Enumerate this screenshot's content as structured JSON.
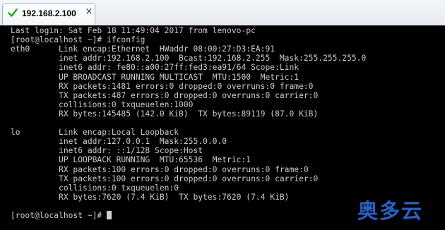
{
  "tab": {
    "label": "192.168.2.100",
    "status_color": "#2aa82a",
    "status_icon": "check-icon",
    "close_icon": "close-icon",
    "close_glyph": "×"
  },
  "terminal": {
    "lines": [
      "Last login: Sat Feb 18 11:49:04 2017 from lenovo-pc",
      "[root@localhost ~]# ifconfig",
      "eth0      Link encap:Ethernet  HWaddr 08:00:27:D3:EA:91",
      "          inet addr:192.168.2.100  Bcast:192.168.2.255  Mask:255.255.255.0",
      "          inet6 addr: fe80::a00:27ff:fed3:ea91/64 Scope:Link",
      "          UP BROADCAST RUNNING MULTICAST  MTU:1500  Metric:1",
      "          RX packets:1481 errors:0 dropped:0 overruns:0 frame:0",
      "          TX packets:487 errors:0 dropped:0 overruns:0 carrier:0",
      "          collisions:0 txqueuelen:1000",
      "          RX bytes:145485 (142.0 KiB)  TX bytes:89119 (87.0 KiB)",
      "",
      "lo        Link encap:Local Loopback",
      "          inet addr:127.0.0.1  Mask:255.0.0.0",
      "          inet6 addr: ::1/128 Scope:Host",
      "          UP LOOPBACK RUNNING  MTU:65536  Metric:1",
      "          RX packets:100 errors:0 dropped:0 overruns:0 frame:0",
      "          TX packets:100 errors:0 dropped:0 overruns:0 carrier:0",
      "          collisions:0 txqueuelen:0",
      "          RX bytes:7620 (7.4 KiB)  TX bytes:7620 (7.4 KiB)",
      "",
      "[root@localhost ~]# "
    ],
    "text_color": "#cfcfcf",
    "background": "#000000"
  },
  "watermark": {
    "text": "奥多云",
    "color": "#2b5fbf"
  }
}
